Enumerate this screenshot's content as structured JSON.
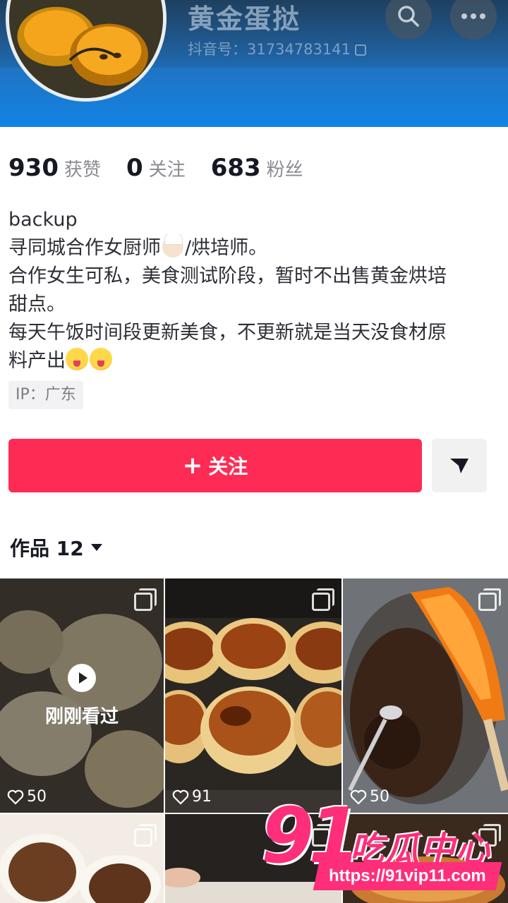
{
  "header": {
    "nickname": "黄金蛋挞",
    "douyin_id": "抖音号：31734783141",
    "search_icon": "search-icon",
    "more_icon": "more-icon"
  },
  "stats": [
    {
      "num": "930",
      "label": "获赞"
    },
    {
      "num": "0",
      "label": "关注"
    },
    {
      "num": "683",
      "label": "粉丝"
    }
  ],
  "bio": {
    "line1": "backup",
    "line2a": "寻同城合作女厨师",
    "line2b": "/烘培师。",
    "line3": "合作女生可私，美食测试阶段，暂时不出售黄金烘培",
    "line4": "甜点。",
    "line5": "每天午饭时间段更新美食，不更新就是当天没食材原",
    "line6": "料产出"
  },
  "ip": "IP：广东",
  "actions": {
    "follow_plus": "+",
    "follow_label": "关注",
    "more_icon": "triangle-share-icon"
  },
  "works": {
    "tab_label": "作品 12",
    "items": [
      {
        "likes": "50",
        "watched_label": "刚刚看过"
      },
      {
        "likes": "91"
      },
      {
        "likes": "50"
      },
      {},
      {},
      {}
    ]
  },
  "watermark": {
    "number": "91",
    "text": "吃瓜中心",
    "url": "https://91vip11.com"
  },
  "colors": {
    "follow_red": "#fe2c55",
    "header_blue": "#1383e4",
    "watermark_pink": "#ff2e7a"
  }
}
